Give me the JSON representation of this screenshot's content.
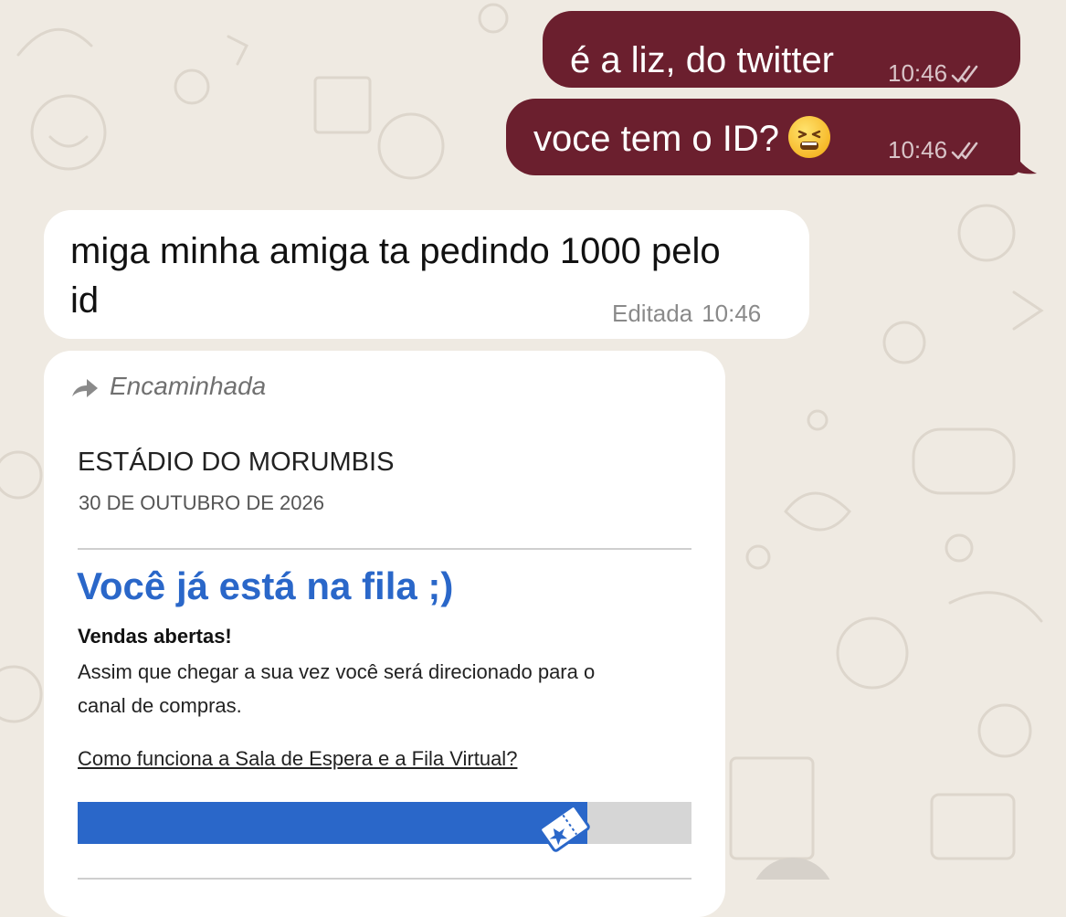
{
  "messages": [
    {
      "text": "é a liz, do twitter",
      "time": "10:46"
    },
    {
      "text": "voce tem o ID?",
      "emoji": "tired-face-emoji",
      "time": "10:46"
    },
    {
      "text_line1": "miga minha amiga ta pedindo 1000 pelo",
      "text_line2": "id",
      "edited_label": "Editada",
      "time": "10:46"
    }
  ],
  "forwarded": {
    "label": "Encaminhada",
    "venue": "ESTÁDIO DO MORUMBIS",
    "date": "30 DE OUTUBRO DE 2026",
    "heading": "Você já está na fila ;)",
    "status_title": "Vendas abertas!",
    "status_line1": "Assim que chegar a sua vez você será direcionado para o",
    "status_line2": "canal de compras.",
    "help_link": "Como funciona a Sala de Espera e a Fila Virtual?",
    "queue_progress": 0.83
  },
  "colors": {
    "outgoing_bubble": "#6b1f2e",
    "accent_blue": "#2a67c9",
    "background": "#efeae2"
  }
}
